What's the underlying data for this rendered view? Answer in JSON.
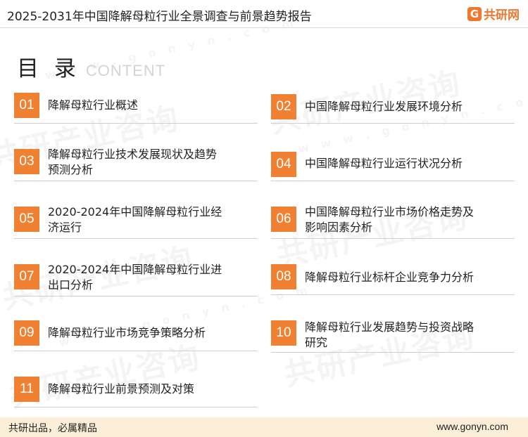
{
  "header": {
    "title": "2025-2031年中国降解母粒行业全景调查与前景趋势报告",
    "logo_mark": "G",
    "logo_text": "共研网"
  },
  "toc": {
    "heading": "目 录",
    "heading_en": "CONTENT",
    "items": [
      {
        "num": "01",
        "line1": "降解母粒行业概述",
        "line2": ""
      },
      {
        "num": "02",
        "line1": "中国降解母粒行业发展环境分析",
        "line2": ""
      },
      {
        "num": "03",
        "line1": "降解母粒行业技术发展现状及趋势",
        "line2": "预测分析"
      },
      {
        "num": "04",
        "line1": "中国降解母粒行业运行状况分析",
        "line2": ""
      },
      {
        "num": "05",
        "line1": "2020-2024年中国降解母粒行业经",
        "line2": "济运行"
      },
      {
        "num": "06",
        "line1": "中国降解母粒行业市场价格走势及",
        "line2": "影响因素分析"
      },
      {
        "num": "07",
        "line1": "2020-2024年中国降解母粒行业进",
        "line2": "出口分析"
      },
      {
        "num": "08",
        "line1": "降解母粒行业标杆企业竞争力分析",
        "line2": ""
      },
      {
        "num": "09",
        "line1": "降解母粒行业市场竞争策略分析",
        "line2": ""
      },
      {
        "num": "10",
        "line1": "降解母粒行业发展趋势与投资战略",
        "line2": "研究"
      },
      {
        "num": "11",
        "line1": "降解母粒行业前景预测及对策",
        "line2": ""
      }
    ]
  },
  "watermark": {
    "text": "共研产业咨询",
    "url": "w w w . g o n y n . c o m"
  },
  "footer": {
    "slogan": "共研出品，必属精品",
    "site": "www.gonyn.com"
  },
  "colors": {
    "accent": "#f08032",
    "footer_bg": "#fcefd8"
  }
}
